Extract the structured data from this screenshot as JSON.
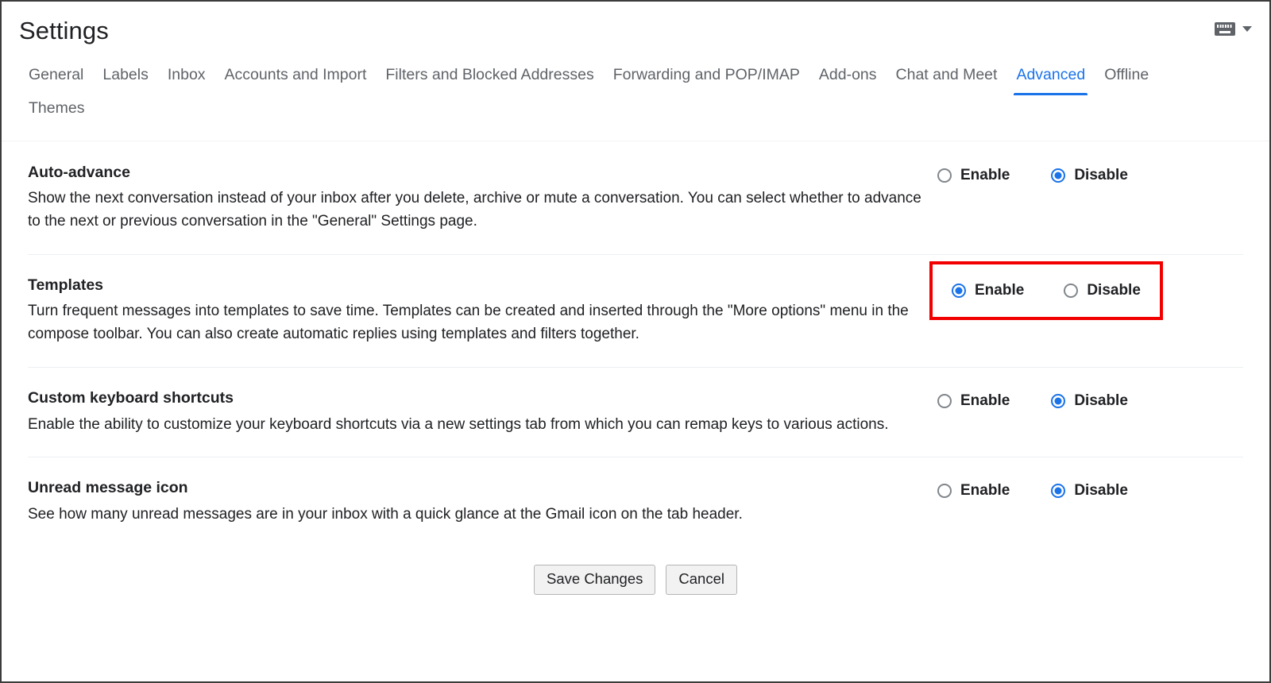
{
  "header": {
    "title": "Settings",
    "keyboard_icon": "keyboard-icon",
    "chevron_icon": "chevron-down-icon"
  },
  "tabs": {
    "row1": [
      {
        "label": "General",
        "active": false
      },
      {
        "label": "Labels",
        "active": false
      },
      {
        "label": "Inbox",
        "active": false
      },
      {
        "label": "Accounts and Import",
        "active": false
      },
      {
        "label": "Filters and Blocked Addresses",
        "active": false
      },
      {
        "label": "Forwarding and POP/IMAP",
        "active": false
      },
      {
        "label": "Add-ons",
        "active": false
      },
      {
        "label": "Chat and Meet",
        "active": false
      },
      {
        "label": "Advanced",
        "active": true
      },
      {
        "label": "Offline",
        "active": false
      }
    ],
    "row2": [
      {
        "label": "Themes",
        "active": false
      }
    ],
    "active_tab": "Advanced",
    "active_color": "#1a73e8"
  },
  "settings": [
    {
      "title": "Auto-advance",
      "description": "Show the next conversation instead of your inbox after you delete, archive or mute a conversation. You can select whether to advance to the next or previous conversation in the \"General\" Settings page.",
      "options": [
        {
          "label": "Enable",
          "selected": false
        },
        {
          "label": "Disable",
          "selected": true
        }
      ],
      "highlighted": false
    },
    {
      "title": "Templates",
      "description": "Turn frequent messages into templates to save time. Templates can be created and inserted through the \"More options\" menu in the compose toolbar. You can also create automatic replies using templates and filters together.",
      "options": [
        {
          "label": "Enable",
          "selected": true
        },
        {
          "label": "Disable",
          "selected": false
        }
      ],
      "highlighted": true,
      "highlight_color": "#f20000"
    },
    {
      "title": "Custom keyboard shortcuts",
      "description": "Enable the ability to customize your keyboard shortcuts via a new settings tab from which you can remap keys to various actions.",
      "options": [
        {
          "label": "Enable",
          "selected": false
        },
        {
          "label": "Disable",
          "selected": true
        }
      ],
      "highlighted": false
    },
    {
      "title": "Unread message icon",
      "description": "See how many unread messages are in your inbox with a quick glance at the Gmail icon on the tab header.",
      "options": [
        {
          "label": "Enable",
          "selected": false
        },
        {
          "label": "Disable",
          "selected": true
        }
      ],
      "highlighted": false
    }
  ],
  "footer": {
    "save_label": "Save Changes",
    "cancel_label": "Cancel"
  }
}
